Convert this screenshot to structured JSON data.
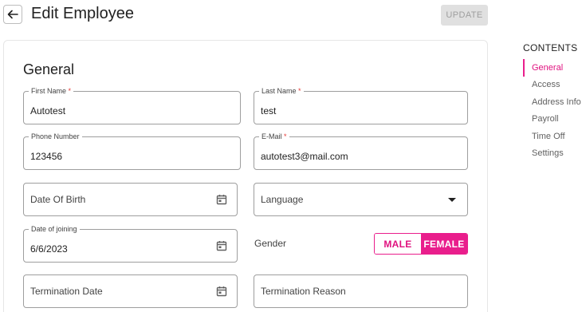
{
  "header": {
    "title": "Edit Employee",
    "update_label": "UPDATE",
    "back_icon": "arrow-left-icon"
  },
  "card": {
    "section_title": "General"
  },
  "fields": {
    "first_name": {
      "label": "First Name",
      "value": "Autotest",
      "required": "*"
    },
    "last_name": {
      "label": "Last Name",
      "value": "test",
      "required": "*"
    },
    "phone": {
      "label": "Phone Number",
      "value": "123456"
    },
    "email": {
      "label": "E-Mail",
      "value": "autotest3@mail.com",
      "required": "*"
    },
    "dob": {
      "placeholder": "Date Of Birth",
      "icon": "calendar-icon"
    },
    "language": {
      "placeholder": "Language",
      "icon": "dropdown-caret-icon"
    },
    "doj": {
      "label": "Date of joining",
      "value": "6/6/2023",
      "icon": "calendar-icon"
    },
    "termination_date": {
      "placeholder": "Termination Date",
      "icon": "calendar-icon"
    },
    "termination_reason": {
      "placeholder": "Termination Reason"
    }
  },
  "gender": {
    "label": "Gender",
    "options": [
      "MALE",
      "FEMALE"
    ],
    "selected": "FEMALE"
  },
  "contents": {
    "title": "CONTENTS",
    "items": [
      "General",
      "Access",
      "Address Info",
      "Payroll",
      "Time Off",
      "Settings"
    ],
    "active": "General"
  },
  "colors": {
    "accent": "#e91e8c",
    "border": "#9e9e9e",
    "disabled_bg": "#e0e0e0"
  }
}
